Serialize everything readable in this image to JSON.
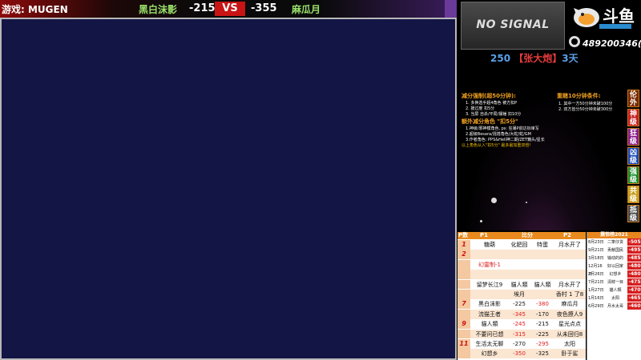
{
  "topbar": {
    "game_label": "游戏: MUGEN",
    "player1": "黑白沫影",
    "score1": "-215",
    "vs": "VS",
    "score2": "-355",
    "player2": "麻瓜月"
  },
  "monitor": {
    "status": "NO SIGNAL"
  },
  "brand": {
    "name": "斗鱼"
  },
  "group": {
    "qq": "489200346(群)"
  },
  "streak": {
    "count": "250",
    "name": "【张大炮】",
    "days": "3天"
  },
  "rules": {
    "left_title": "减分强制(超50分钟):",
    "left_lines": [
      "1. 多换选手超4角色 被方扣P",
      "2. 援过度 扣5分",
      "3. 当屏 自杀/平局/摆锤 扣10分"
    ],
    "mid_title": "额外减分角色 \"扣5分\"",
    "mid_lines": [
      "1.神级/邪神模角色, ps: 狂暴P前达标审写",
      "2.超级Besara/混搭角色/大蛇/蛇/GM",
      "3.作者角色: PPS&Hell神二期/ZET魑头/星长"
    ],
    "warn_line": "以上角色从入\"扣5分\" 最多最加重双倍!",
    "right_title": "重赌10分钟条件:",
    "right_lines": [
      "1. 其中一方50分钟未破100分",
      "2. 双方皆分50分钟未破300分"
    ]
  },
  "side_tags": [
    "伦外",
    "神级",
    "狂级",
    "凶级",
    "强级",
    "共级",
    "抵级"
  ],
  "board": {
    "headers": {
      "no": "P数",
      "p1": "P1",
      "score": "比分",
      "p2": "P2"
    },
    "rows": [
      {
        "no": "1",
        "a": "糖葫",
        "b": "化肥回",
        "c": "特蛋",
        "d": "月水开了"
      },
      {
        "no": "2",
        "a": "",
        "b": "",
        "c": "",
        "d": ""
      },
      {
        "no": "",
        "a": "幻靈制-1",
        "b": "",
        "c": "",
        "d": "",
        "red_a": true
      },
      {
        "no": "",
        "a": "",
        "b": "",
        "c": "",
        "d": ""
      },
      {
        "no": "",
        "a": "留梦长江9",
        "b": "貓人類",
        "c": "貓人類",
        "d": "月水开了"
      },
      {
        "no": "",
        "a": "",
        "b": "埃月",
        "c": "",
        "d": "香村 1 了8"
      },
      {
        "no": "7",
        "a": "黑白沫影",
        "b": "-225",
        "c": "-380",
        "d": "麻瓜月",
        "red_c": true
      },
      {
        "no": "",
        "a": "流猫王者",
        "b": "-345",
        "c": "-170",
        "d": "夜色撩人9",
        "red_b": true
      },
      {
        "no": "9",
        "a": "貓人類",
        "b": "-245",
        "c": "-215",
        "d": "星光点点",
        "red_b": true
      },
      {
        "no": "",
        "a": "不要问已想",
        "b": "-315",
        "c": "-225",
        "d": "从未回归8",
        "red_b": true
      },
      {
        "no": "11",
        "a": "生活太无聊",
        "b": "-270",
        "c": "-295",
        "d": "太阳",
        "red_c": true
      },
      {
        "no": "",
        "a": "幻想乡",
        "b": "-350",
        "c": "-325",
        "d": "卧于鲨",
        "red_b": true
      }
    ]
  },
  "history": {
    "title": "震惊榜2021",
    "rows": [
      {
        "date": "8月23日",
        "name": "二笨仔货",
        "val": "-505"
      },
      {
        "date": "9月21日",
        "name": "贡献国民",
        "val": "-495"
      },
      {
        "date": "3月18日",
        "name": "输动的的",
        "val": "-485"
      },
      {
        "date": "12月16日",
        "name": "好以回家",
        "val": "-480"
      },
      {
        "date": "2月26日",
        "name": "幻想乡",
        "val": "-480"
      },
      {
        "date": "7月21日",
        "name": "清鲜一目",
        "val": "-475"
      },
      {
        "date": "1月27日",
        "name": "貓人類",
        "val": "-470"
      },
      {
        "date": "1月16日",
        "name": "太阳",
        "val": "-465"
      },
      {
        "date": "6月29日",
        "name": "月水太哥",
        "val": "-460"
      }
    ]
  }
}
